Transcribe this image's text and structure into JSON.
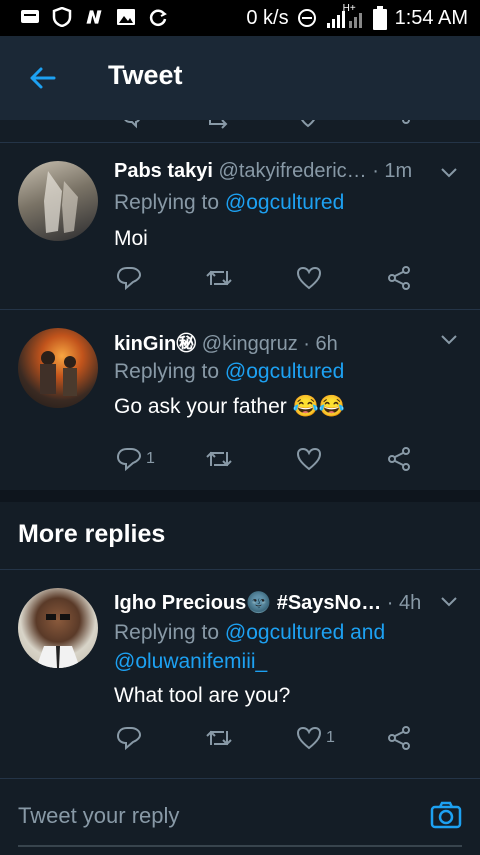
{
  "status_bar": {
    "speed": "0 k/s",
    "network": "H+",
    "time": "1:54 AM"
  },
  "header": {
    "title": "Tweet"
  },
  "tweets": [
    {
      "name": "Pabs takyi",
      "handle": "@takyifrederic…",
      "time": "· 1m",
      "replying_prefix": "Replying to ",
      "replying_to": "@ogcultured",
      "text": "Moi",
      "reply_count": "",
      "like_count": ""
    },
    {
      "name": "kinGin㊙",
      "handle": "@kingqruz",
      "time": "· 6h",
      "replying_prefix": "Replying to ",
      "replying_to": "@ogcultured",
      "text": "Go ask your father 😂😂",
      "reply_count": "1",
      "like_count": ""
    }
  ],
  "more_replies": {
    "heading": "More replies",
    "tweet": {
      "name": "Igho Precious🌚 #SaysNo…",
      "handle": "",
      "time": "· 4h",
      "replying_prefix": "Replying to ",
      "replying_to": "@ogcultured and",
      "replying_to_2": "@oluwanifemiii_",
      "text": "What tool are you?",
      "reply_count": "",
      "like_count": "1"
    }
  },
  "composer": {
    "placeholder": "Tweet your reply"
  },
  "colors": {
    "background": "#141d26",
    "accent": "#1da1f2",
    "muted": "#8899a6"
  }
}
